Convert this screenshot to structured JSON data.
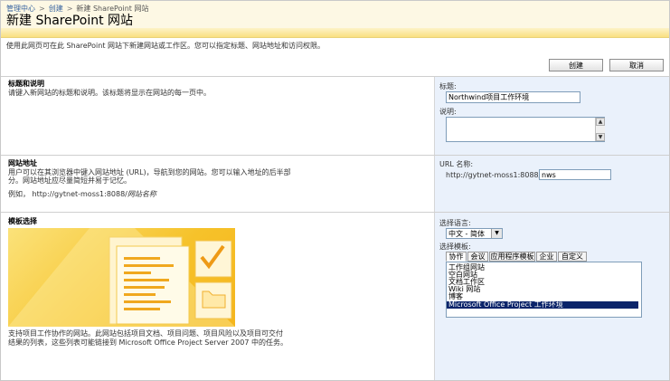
{
  "breadcrumb": {
    "items": [
      "管理中心",
      "创建",
      "新建 SharePoint 网站"
    ]
  },
  "page_title": "新建 SharePoint 网站",
  "description": "使用此网页可在此 SharePoint 网站下新建网站或工作区。您可以指定标题、网站地址和访问权限。",
  "buttons": {
    "create": "创建",
    "cancel": "取消"
  },
  "sections": {
    "title_desc": {
      "heading": "标题和说明",
      "text": "请键入新网站的标题和说明。该标题将显示在网站的每一页中。",
      "title_label": "标题:",
      "title_value": "Northwind项目工作环境",
      "desc_label": "说明:",
      "desc_value": ""
    },
    "url": {
      "heading": "网站地址",
      "text1": "用户可以在其浏览器中键入网站地址 (URL)，导航到您的网站。您可以输入地址的后半部",
      "text2": "分。网站地址应尽量简短并易于记忆。",
      "example_prefix": "例如，  http://gytnet-moss1:8088/",
      "example_suffix": "网站名称",
      "url_label": "URL 名称:",
      "url_prefix": "http://gytnet-moss1:8088/",
      "url_value": "nws"
    },
    "template": {
      "heading": "模板选择",
      "text1": "支持项目工作协作的网站。此网站包括项目文档、项目问题、项目风险以及项目可交付",
      "text2": "结果的列表，这些列表可能链接到 Microsoft Office Project Server 2007 中的任务。",
      "lang_label": "选择语言:",
      "lang_value": "中文 - 简体",
      "template_label": "选择模板:",
      "tabs": [
        "协作",
        "会议",
        "应用程序模板",
        "企业",
        "自定义"
      ],
      "items": [
        "工作组网站",
        "空白网站",
        "文档工作区",
        "Wiki 网站",
        "博客",
        "Microsoft Office Project 工作环境"
      ]
    }
  }
}
